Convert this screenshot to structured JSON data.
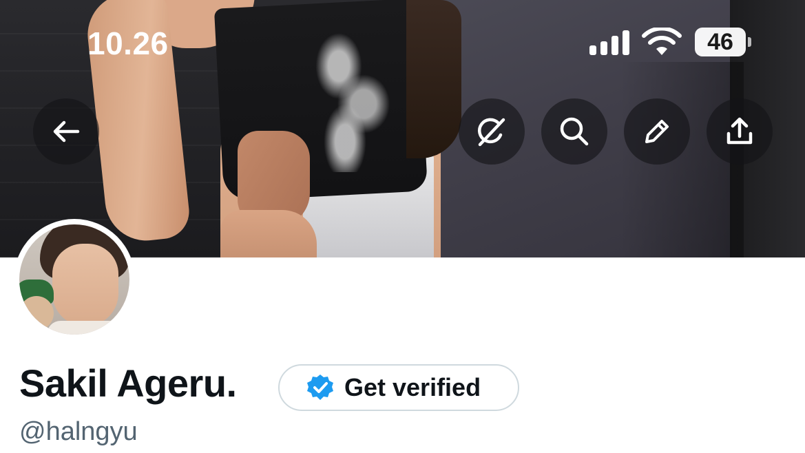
{
  "status_bar": {
    "time": "10.26",
    "battery": "46",
    "icons": [
      "cellular-signal-icon",
      "wifi-icon",
      "battery-icon"
    ]
  },
  "header": {
    "buttons": [
      {
        "name": "back-button",
        "icon": "arrow-left-icon"
      },
      {
        "name": "grok-button",
        "icon": "grok-icon"
      },
      {
        "name": "search-button",
        "icon": "search-icon"
      },
      {
        "name": "edit-button",
        "icon": "pencil-icon"
      },
      {
        "name": "share-button",
        "icon": "share-icon"
      }
    ]
  },
  "profile": {
    "display_name": "Sakil Ageru.",
    "handle": "@halngyu",
    "verify_label": "Get verified"
  },
  "colors": {
    "verified_badge": "#1d9bf0",
    "text_primary": "#0f1419",
    "text_secondary": "#536471",
    "border": "#cfd9de"
  }
}
